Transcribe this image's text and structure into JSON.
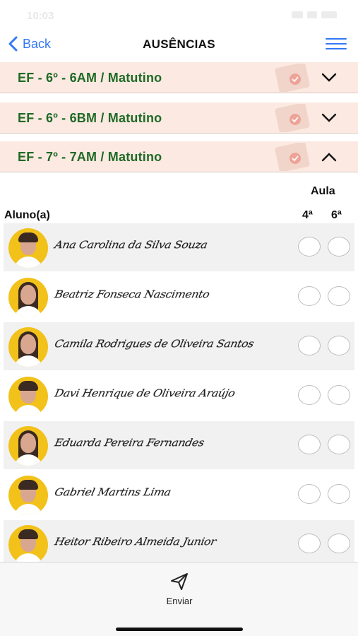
{
  "status_bar": {
    "time": "10:03"
  },
  "nav": {
    "back_label": "Back",
    "title": "AUSÊNCIAS"
  },
  "sections": [
    {
      "title": "EF - 6º - 6AM / Matutino",
      "expanded": false
    },
    {
      "title": "EF - 6º - 6BM / Matutino",
      "expanded": false
    },
    {
      "title": "EF - 7º - 7AM / Matutino",
      "expanded": true
    }
  ],
  "table": {
    "aula_label": "Aula",
    "student_header": "Aluno(a)",
    "periods": [
      "4ª",
      "6ª"
    ],
    "students": [
      {
        "name": "Ana Carolina da Silva Souza"
      },
      {
        "name": "Beatriz Fonseca Nascimento"
      },
      {
        "name": "Camila Rodrigues de Oliveira Santos"
      },
      {
        "name": "Davi Henrique de Oliveira Araújo"
      },
      {
        "name": "Eduarda Pereira Fernandes"
      },
      {
        "name": "Gabriel Martins Lima"
      },
      {
        "name": "Heitor Ribeiro Almeida Junior"
      }
    ]
  },
  "footer": {
    "send_label": "Enviar"
  },
  "colors": {
    "accent": "#3478f6",
    "section_bg": "#fbe9e2",
    "section_text": "#1f6a25",
    "row_shade": "#f1f1f1"
  }
}
